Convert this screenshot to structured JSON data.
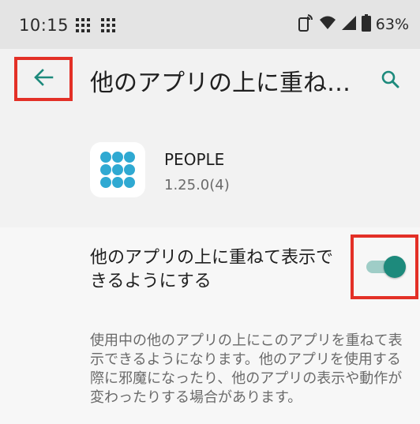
{
  "status_bar": {
    "time": "10:15",
    "battery": "63%"
  },
  "app_bar": {
    "title": "他のアプリの上に重ね…"
  },
  "app_info": {
    "name": "PEOPLE",
    "version": "1.25.0(4)"
  },
  "setting": {
    "label": "他のアプリの上に重ねて表示できるようにする",
    "enabled": true,
    "description": "使用中の他のアプリの上にこのアプリを重ねて表示できるようになります。他のアプリを使用する際に邪魔になったり、他のアプリの表示や動作が変わったりする場合があります。"
  },
  "colors": {
    "accent": "#1d8a7c",
    "accent_track": "#9fcdc7",
    "highlight_frame": "#e33027",
    "app_icon_dots": "#2fa9d2"
  },
  "icons": [
    "grid-notification-icon",
    "grid-notification-icon",
    "nfc-icon",
    "wifi-icon",
    "signal-icon",
    "battery-icon",
    "back-arrow-icon",
    "search-icon",
    "people-app-icon"
  ]
}
